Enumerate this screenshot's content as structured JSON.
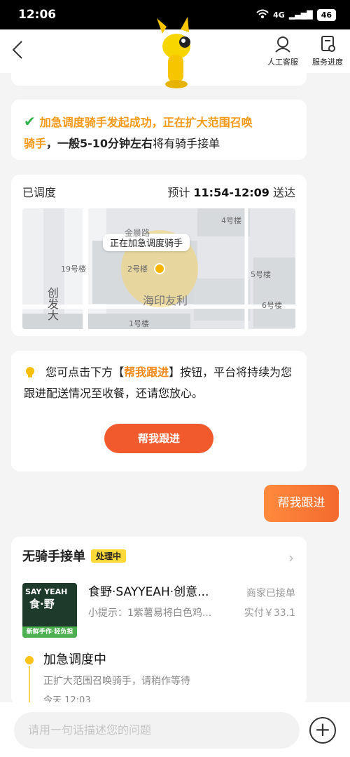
{
  "status": {
    "time": "12:06",
    "signal": "4G",
    "battery": "46"
  },
  "header": {
    "back_icon": "chevron-left-icon",
    "service_label": "人工客服",
    "progress_label": "服务进度"
  },
  "notice": {
    "part1": "加急调度骑手发起成功，",
    "part2": "正在扩大范围召唤",
    "part3": "骑手",
    "part4": "，一般5-10分钟左右",
    "part5": "将有骑手接单"
  },
  "delivery": {
    "status": "已调度",
    "eta_prefix": "预计 ",
    "eta_time": "11:54-12:09",
    "eta_suffix": " 送达",
    "map_tooltip": "正在加急调度骑手",
    "map_labels": [
      "19号楼",
      "2号楼",
      "4号楼",
      "5号楼",
      "6号楼",
      "1号楼",
      "海印友利",
      "创发大",
      "金晨路"
    ]
  },
  "help": {
    "text1": "您可点击下方【",
    "highlight": "帮我跟进",
    "text2": "】按钮，平台将持续为您跟进配送情况至收餐，还请您放心。",
    "button_label": "帮我跟进"
  },
  "chat_bubble": "帮我跟进",
  "order": {
    "title": "无骑手接单",
    "badge": "处理中",
    "shop_logo_line1": "SAY YEAH",
    "shop_logo_line2": "食·野",
    "shop_logo_line3": "新鲜手作·轻负担",
    "shop_name": "食野·SAYYEAH·创意...",
    "tip": "小提示：1紫薯易将白色鸡...",
    "merchant_status": "商家已接单",
    "paid": "实付￥33.1",
    "timeline_title": "加急调度中",
    "timeline_desc": "正扩大范围召唤骑手，请稍作等待",
    "timeline_time": "今天 12:03"
  },
  "input": {
    "placeholder": "请用一句话描述您的问题"
  }
}
